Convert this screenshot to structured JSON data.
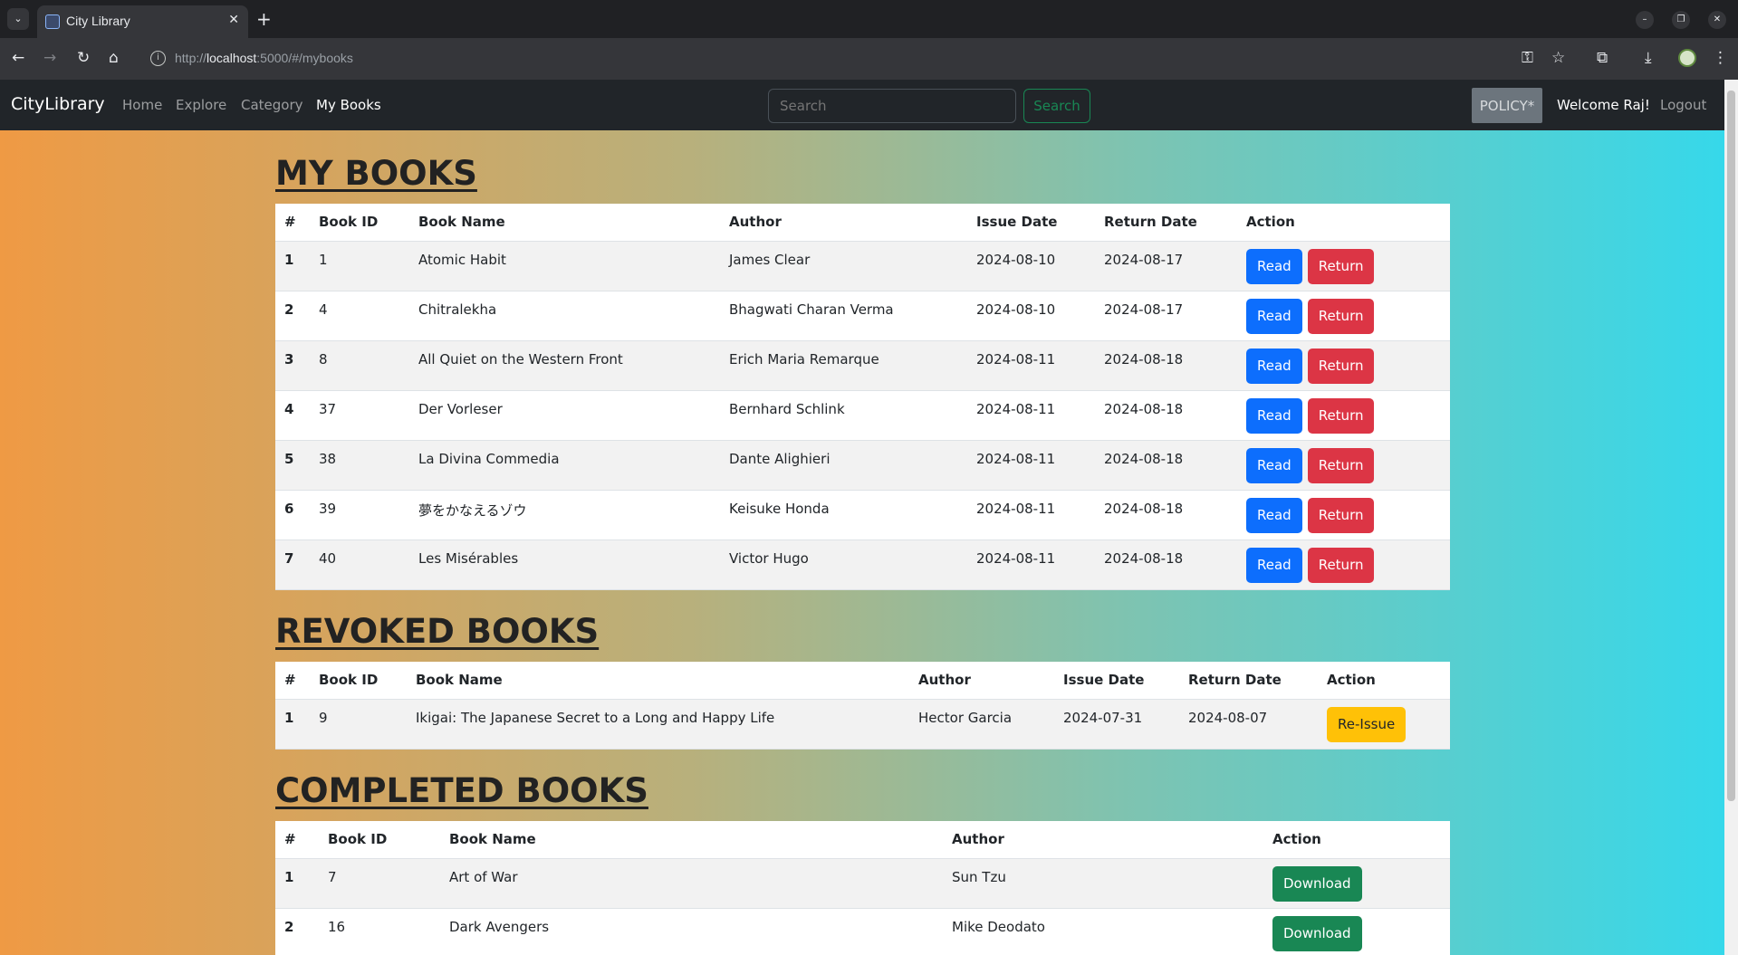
{
  "browser": {
    "tab_title": "City Library",
    "url_prefix": "http://",
    "url_host": "localhost",
    "url_rest": ":5000/#/mybooks"
  },
  "navbar": {
    "brand": "CityLibrary",
    "links": [
      "Home",
      "Explore",
      "Category",
      "My Books"
    ],
    "search_placeholder": "Search",
    "search_button": "Search",
    "policy_button": "POLICY*",
    "welcome": "Welcome Raj!",
    "logout": "Logout"
  },
  "my_books": {
    "title": "MY BOOKS",
    "headers": [
      "#",
      "Book ID",
      "Book Name",
      "Author",
      "Issue Date",
      "Return Date",
      "Action"
    ],
    "rows": [
      {
        "n": "1",
        "id": "1",
        "name": "Atomic Habit",
        "author": "James Clear",
        "issue": "2024-08-10",
        "return": "2024-08-17"
      },
      {
        "n": "2",
        "id": "4",
        "name": "Chitralekha",
        "author": "Bhagwati Charan Verma",
        "issue": "2024-08-10",
        "return": "2024-08-17"
      },
      {
        "n": "3",
        "id": "8",
        "name": "All Quiet on the Western Front",
        "author": "Erich Maria Remarque",
        "issue": "2024-08-11",
        "return": "2024-08-18"
      },
      {
        "n": "4",
        "id": "37",
        "name": "Der Vorleser",
        "author": "Bernhard Schlink",
        "issue": "2024-08-11",
        "return": "2024-08-18"
      },
      {
        "n": "5",
        "id": "38",
        "name": "La Divina Commedia",
        "author": "Dante Alighieri",
        "issue": "2024-08-11",
        "return": "2024-08-18"
      },
      {
        "n": "6",
        "id": "39",
        "name": "夢をかなえるゾウ",
        "author": "Keisuke Honda",
        "issue": "2024-08-11",
        "return": "2024-08-18"
      },
      {
        "n": "7",
        "id": "40",
        "name": "Les Misérables",
        "author": "Victor Hugo",
        "issue": "2024-08-11",
        "return": "2024-08-18"
      }
    ],
    "read_label": "Read",
    "return_label": "Return"
  },
  "revoked_books": {
    "title": "REVOKED BOOKS",
    "headers": [
      "#",
      "Book ID",
      "Book Name",
      "Author",
      "Issue Date",
      "Return Date",
      "Action"
    ],
    "rows": [
      {
        "n": "1",
        "id": "9",
        "name": "Ikigai: The Japanese Secret to a Long and Happy Life",
        "author": "Hector Garcia",
        "issue": "2024-07-31",
        "return": "2024-08-07"
      }
    ],
    "reissue_label": "Re-Issue"
  },
  "completed_books": {
    "title": "COMPLETED BOOKS",
    "headers": [
      "#",
      "Book ID",
      "Book Name",
      "Author",
      "Action"
    ],
    "rows": [
      {
        "n": "1",
        "id": "7",
        "name": "Art of War",
        "author": "Sun Tzu"
      },
      {
        "n": "2",
        "id": "16",
        "name": "Dark Avengers",
        "author": "Mike Deodato"
      }
    ],
    "download_label": "Download"
  }
}
